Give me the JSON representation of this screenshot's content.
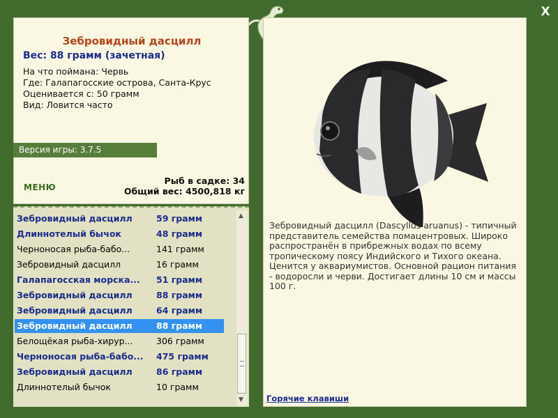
{
  "fish": {
    "title": "Зебровидный дасцилл",
    "weight_line": "Вес: 88 грамм (зачетная)",
    "caught_on": "На что поймана: Червь",
    "location": "Где: Галапагосские острова, Санта-Крус",
    "rated_from": "Оценивается с: 50 грамм",
    "frequency": "Вид: Ловится часто",
    "description": "Зебровидный дасцилл (Dascyllus aruanus) - типичный представитель семейства помацентровых. Широко распространён в прибрежных водах по всему тропическому поясу Индийского и Тихого океана. Ценится у аквариумистов. Основной рацион питания - водоросли и черви. Достигает длины 10 см и массы 100 г."
  },
  "version": "Версия игры: 3.7.5",
  "menu_label": "МЕНЮ",
  "stats": {
    "count": "Рыб в садке: 34",
    "total": "Общий вес: 4500,818 кг"
  },
  "catch_list": [
    {
      "name": "Зебровидный дасцилл",
      "weight": "59 грамм",
      "style": "hl"
    },
    {
      "name": "Длиннотелый бычок",
      "weight": "48 грамм",
      "style": "hl"
    },
    {
      "name": "Черноносая рыба-бабо...",
      "weight": "141 грамм",
      "style": "normal"
    },
    {
      "name": "Зебровидный дасцилл",
      "weight": "16 грамм",
      "style": "normal"
    },
    {
      "name": "Галапагосская морска...",
      "weight": "51 грамм",
      "style": "hl"
    },
    {
      "name": "Зебровидный дасцилл",
      "weight": "88 грамм",
      "style": "hl"
    },
    {
      "name": "Зебровидный дасцилл",
      "weight": "64 грамм",
      "style": "hl"
    },
    {
      "name": "Зебровидный дасцилл",
      "weight": "88 грамм",
      "style": "sel"
    },
    {
      "name": "Белощёкая рыба-хирур...",
      "weight": "306 грамм",
      "style": "normal"
    },
    {
      "name": "Черноносая рыба-бабо...",
      "weight": "475 грамм",
      "style": "hl"
    },
    {
      "name": "Зебровидный дасцилл",
      "weight": "86 грамм",
      "style": "hl"
    },
    {
      "name": "Длиннотелый бычок",
      "weight": "10 грамм",
      "style": "normal"
    }
  ],
  "hotkeys_label": "Горячие клавиши",
  "close_label": "X",
  "colors": {
    "frame": "#416b2c",
    "panel": "#faf7e2",
    "title": "#b3461b",
    "highlight_text": "#1b2d8a",
    "selected_row": "#3591ef"
  },
  "icons": {
    "mascot": "lizard-icon",
    "close": "close-icon",
    "scroll_up": "scroll-up-arrow-icon",
    "scroll_down": "scroll-down-arrow-icon"
  }
}
